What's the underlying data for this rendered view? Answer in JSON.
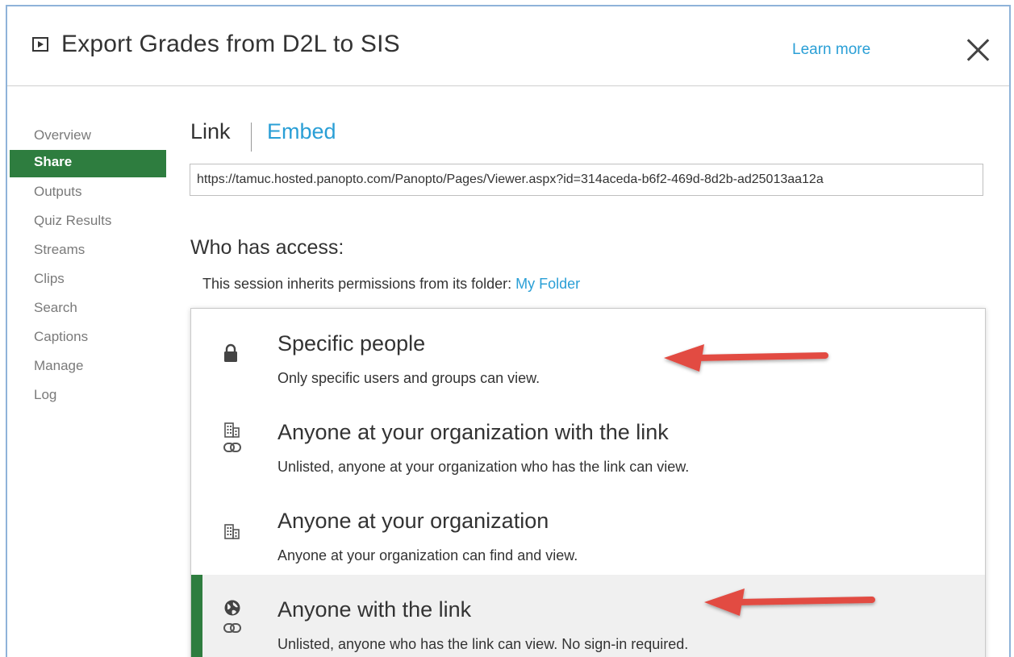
{
  "header": {
    "title": "Export Grades from D2L to SIS",
    "learn_more": "Learn more",
    "video_icon": "play-video-icon",
    "close_icon": "close-icon"
  },
  "sidebar": {
    "items": [
      {
        "label": "Overview",
        "active": false
      },
      {
        "label": "Share",
        "active": true
      },
      {
        "label": "Outputs",
        "active": false
      },
      {
        "label": "Quiz Results",
        "active": false
      },
      {
        "label": "Streams",
        "active": false
      },
      {
        "label": "Clips",
        "active": false
      },
      {
        "label": "Search",
        "active": false
      },
      {
        "label": "Captions",
        "active": false
      },
      {
        "label": "Manage",
        "active": false
      },
      {
        "label": "Log",
        "active": false
      }
    ]
  },
  "share": {
    "tabs": {
      "link": "Link",
      "embed": "Embed"
    },
    "url": "https://tamuc.hosted.panopto.com/Panopto/Pages/Viewer.aspx?id=314aceda-b6f2-469d-8d2b-ad25013aa12a",
    "access_heading": "Who has access:",
    "inherits_text": "This session inherits permissions from its folder: ",
    "folder_name": "My Folder",
    "options": [
      {
        "title": "Specific people",
        "desc": "Only specific users and groups can view.",
        "icons": [
          "lock-icon"
        ],
        "selected": false
      },
      {
        "title": "Anyone at your organization with the link",
        "desc": "Unlisted, anyone at your organization who has the link can view.",
        "icons": [
          "building-icon",
          "link-icon"
        ],
        "selected": false
      },
      {
        "title": "Anyone at your organization",
        "desc": "Anyone at your organization can find and view.",
        "icons": [
          "building-icon"
        ],
        "selected": false
      },
      {
        "title": "Anyone with the link",
        "desc": "Unlisted, anyone who has the link can view. No sign-in required.",
        "icons": [
          "globe-icon",
          "link-icon"
        ],
        "selected": true
      }
    ]
  },
  "colors": {
    "accent_green": "#2e7d3f",
    "link_blue": "#2a9fd6",
    "annotation_arrow": "#e24b43"
  }
}
